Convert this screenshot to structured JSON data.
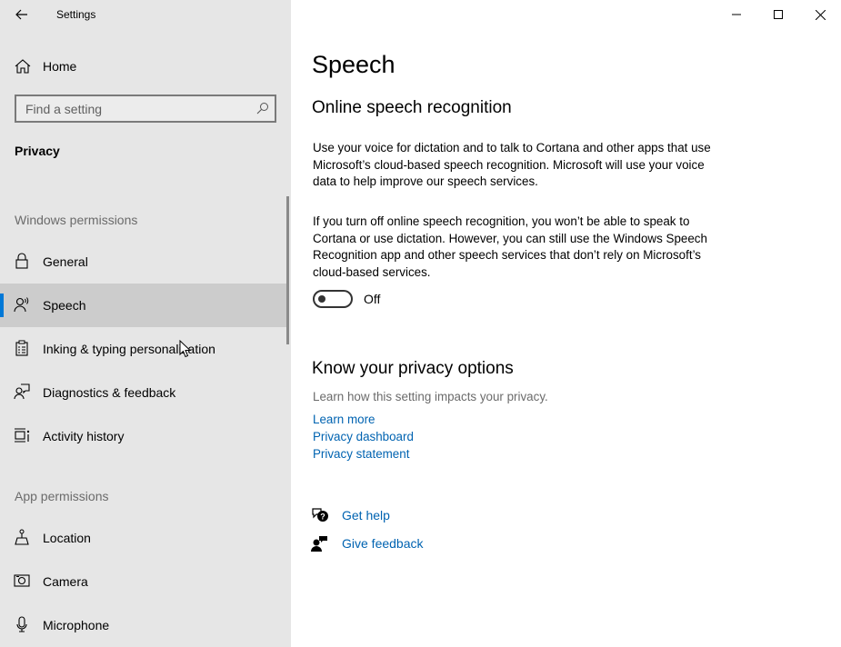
{
  "window": {
    "title": "Settings",
    "controls": {
      "minimize": "minimize-icon",
      "maximize": "maximize-icon",
      "close": "close-icon"
    }
  },
  "sidebar": {
    "back_icon": "back-arrow-icon",
    "home": {
      "label": "Home",
      "icon": "home-icon"
    },
    "search": {
      "placeholder": "Find a setting",
      "value": "",
      "icon": "search-icon"
    },
    "section_title": "Privacy",
    "groups": [
      {
        "label": "Windows permissions",
        "items": [
          {
            "label": "General",
            "icon": "lock-icon",
            "selected": false
          },
          {
            "label": "Speech",
            "icon": "speech-icon",
            "selected": true
          },
          {
            "label": "Inking & typing personalization",
            "icon": "clipboard-icon",
            "selected": false
          },
          {
            "label": "Diagnostics & feedback",
            "icon": "diagnostics-icon",
            "selected": false
          },
          {
            "label": "Activity history",
            "icon": "activity-history-icon",
            "selected": false
          }
        ]
      },
      {
        "label": "App permissions",
        "items": [
          {
            "label": "Location",
            "icon": "location-icon",
            "selected": false
          },
          {
            "label": "Camera",
            "icon": "camera-icon",
            "selected": false
          },
          {
            "label": "Microphone",
            "icon": "microphone-icon",
            "selected": false
          }
        ]
      }
    ]
  },
  "main": {
    "title": "Speech",
    "online_speech": {
      "heading": "Online speech recognition",
      "description1": "Use your voice for dictation and to talk to Cortana and other apps that use Microsoft’s cloud-based speech recognition. Microsoft will use your voice data to help improve our speech services.",
      "description2": "If you turn off online speech recognition, you won’t be able to speak to Cortana or use dictation. However, you can still use the Windows Speech Recognition app and other speech services that don’t rely on Microsoft’s cloud-based services.",
      "toggle": {
        "state": false,
        "label": "Off"
      }
    },
    "privacy_options": {
      "heading": "Know your privacy options",
      "description": "Learn how this setting impacts your privacy.",
      "links": [
        "Learn more",
        "Privacy dashboard",
        "Privacy statement"
      ]
    },
    "help": [
      {
        "label": "Get help",
        "icon": "get-help-icon"
      },
      {
        "label": "Give feedback",
        "icon": "give-feedback-icon"
      }
    ]
  },
  "colors": {
    "accent": "#0078d7",
    "link": "#0063b1",
    "sidebar_bg": "#e6e6e6",
    "selected_bg": "#cccccc",
    "muted_text": "#6b6b6b"
  }
}
